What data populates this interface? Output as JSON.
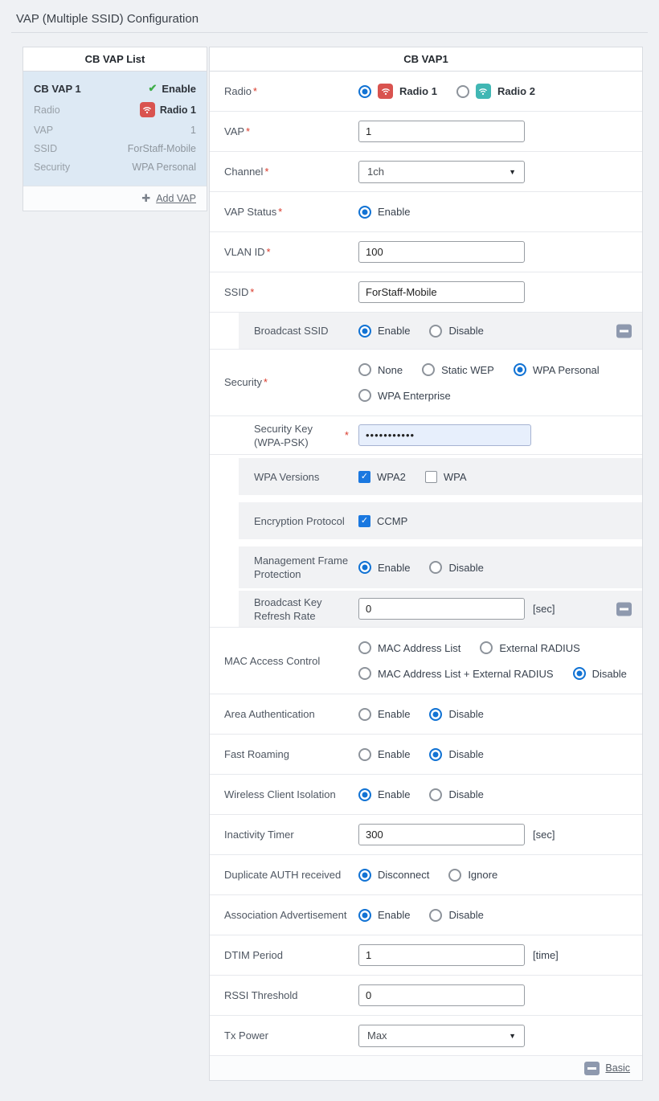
{
  "ui": {
    "required_mark": "*"
  },
  "icons": {
    "check_bold": "✔",
    "checkbox_check": "✓",
    "plus": "✚",
    "dropdown_arrow": "▼"
  },
  "colors": {
    "accent_blue": "#1273d4",
    "radio1_red": "#d9534f",
    "radio2_teal": "#41b7b4",
    "check_green": "#3fae49",
    "minus_gray": "#8e99ae",
    "key_field_bg": "#e7effc",
    "selected_item_bg": "#dde9f4"
  },
  "page_title": "VAP (Multiple SSID) Configuration",
  "vap_list": {
    "title": "CB VAP List",
    "item": {
      "name": "CB VAP 1",
      "status": "Enable",
      "radio_label": "Radio",
      "radio_value": "Radio 1",
      "vap_label": "VAP",
      "vap_value": "1",
      "ssid_label": "SSID",
      "ssid_value": "ForStaff-Mobile",
      "security_label": "Security",
      "security_value": "WPA Personal"
    },
    "add_label": "Add VAP"
  },
  "panel_title": "CB VAP1",
  "form": {
    "radio": {
      "label": "Radio",
      "options": [
        "Radio 1",
        "Radio 2"
      ],
      "selected": "Radio 1"
    },
    "vap": {
      "label": "VAP",
      "value": "1"
    },
    "channel": {
      "label": "Channel",
      "value": "1ch"
    },
    "vap_status": {
      "label": "VAP Status",
      "options": [
        "Enable"
      ],
      "selected": "Enable"
    },
    "vlan_id": {
      "label": "VLAN ID",
      "value": "100"
    },
    "ssid": {
      "label": "SSID",
      "value": "ForStaff-Mobile"
    },
    "broadcast_ssid": {
      "label": "Broadcast SSID",
      "options": [
        "Enable",
        "Disable"
      ],
      "selected": "Enable"
    },
    "security": {
      "label": "Security",
      "options": [
        "None",
        "Static WEP",
        "WPA Personal",
        "WPA Enterprise"
      ],
      "selected": "WPA Personal"
    },
    "security_key": {
      "label": "Security Key (WPA-PSK)",
      "value": "•••••••••••"
    },
    "wpa_versions": {
      "label": "WPA Versions",
      "options": [
        "WPA2",
        "WPA"
      ],
      "checked": [
        "WPA2"
      ]
    },
    "encryption_protocol": {
      "label": "Encryption Protocol",
      "options": [
        "CCMP"
      ],
      "checked": [
        "CCMP"
      ]
    },
    "management_frame_protection": {
      "label": "Management Frame Protection",
      "options": [
        "Enable",
        "Disable"
      ],
      "selected": "Enable"
    },
    "broadcast_key_refresh_rate": {
      "label": "Broadcast Key Refresh Rate",
      "value": "0",
      "unit": "[sec]"
    },
    "mac_access_control": {
      "label": "MAC Access Control",
      "options": [
        "MAC Address List",
        "External RADIUS",
        "MAC Address List + External RADIUS",
        "Disable"
      ],
      "selected": "Disable"
    },
    "area_authentication": {
      "label": "Area Authentication",
      "options": [
        "Enable",
        "Disable"
      ],
      "selected": "Disable"
    },
    "fast_roaming": {
      "label": "Fast Roaming",
      "options": [
        "Enable",
        "Disable"
      ],
      "selected": "Disable"
    },
    "wireless_client_isolation": {
      "label": "Wireless Client Isolation",
      "options": [
        "Enable",
        "Disable"
      ],
      "selected": "Enable"
    },
    "inactivity_timer": {
      "label": "Inactivity Timer",
      "value": "300",
      "unit": "[sec]"
    },
    "duplicate_auth": {
      "label": "Duplicate AUTH received",
      "options": [
        "Disconnect",
        "Ignore"
      ],
      "selected": "Disconnect"
    },
    "association_advertisement": {
      "label": "Association Advertisement",
      "options": [
        "Enable",
        "Disable"
      ],
      "selected": "Enable"
    },
    "dtim_period": {
      "label": "DTIM Period",
      "value": "1",
      "unit": "[time]"
    },
    "rssi_threshold": {
      "label": "RSSI Threshold",
      "value": "0"
    },
    "tx_power": {
      "label": "Tx Power",
      "value": "Max"
    },
    "footer_link": "Basic"
  }
}
